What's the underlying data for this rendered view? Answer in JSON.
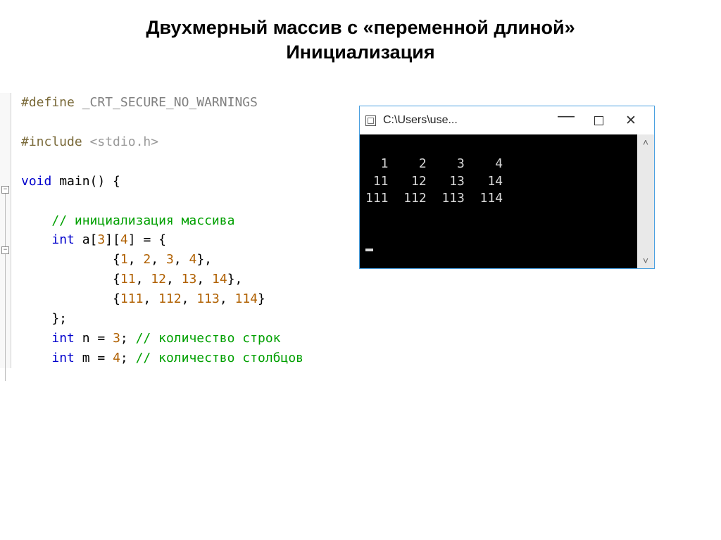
{
  "title_line1": "Двухмерный массив с «переменной длиной»",
  "title_line2": "Инициализация",
  "code": {
    "l1_a": "#define ",
    "l1_b": "_CRT_SECURE_NO_WARNINGS",
    "l3_a": "#include ",
    "l3_b": "<stdio.h>",
    "l5_a": "void",
    "l5_b": " main() {",
    "l7_a": "    ",
    "l7_b": "// инициализация массива",
    "l8_a": "    ",
    "l8_b": "int",
    "l8_c": " a[",
    "l8_d": "3",
    "l8_e": "][",
    "l8_f": "4",
    "l8_g": "] = {",
    "l9_a": "            {",
    "l9_b": "1",
    "l9_c": ", ",
    "l9_d": "2",
    "l9_e": ", ",
    "l9_f": "3",
    "l9_g": ", ",
    "l9_h": "4",
    "l9_i": "},",
    "l10_a": "            {",
    "l10_b": "11",
    "l10_c": ", ",
    "l10_d": "12",
    "l10_e": ", ",
    "l10_f": "13",
    "l10_g": ", ",
    "l10_h": "14",
    "l10_i": "},",
    "l11_a": "            {",
    "l11_b": "111",
    "l11_c": ", ",
    "l11_d": "112",
    "l11_e": ", ",
    "l11_f": "113",
    "l11_g": ", ",
    "l11_h": "114",
    "l11_i": "}",
    "l12_a": "    };",
    "l13_a": "    ",
    "l13_b": "int",
    "l13_c": " n = ",
    "l13_d": "3",
    "l13_e": "; ",
    "l13_f": "// количество строк",
    "l14_a": "    ",
    "l14_b": "int",
    "l14_c": " m = ",
    "l14_d": "4",
    "l14_e": "; ",
    "l14_f": "// количество столбцов"
  },
  "console": {
    "title": "C:\\Users\\use...",
    "row1": "  1    2    3    4",
    "row2": " 11   12   13   14",
    "row3": "111  112  113  114"
  }
}
